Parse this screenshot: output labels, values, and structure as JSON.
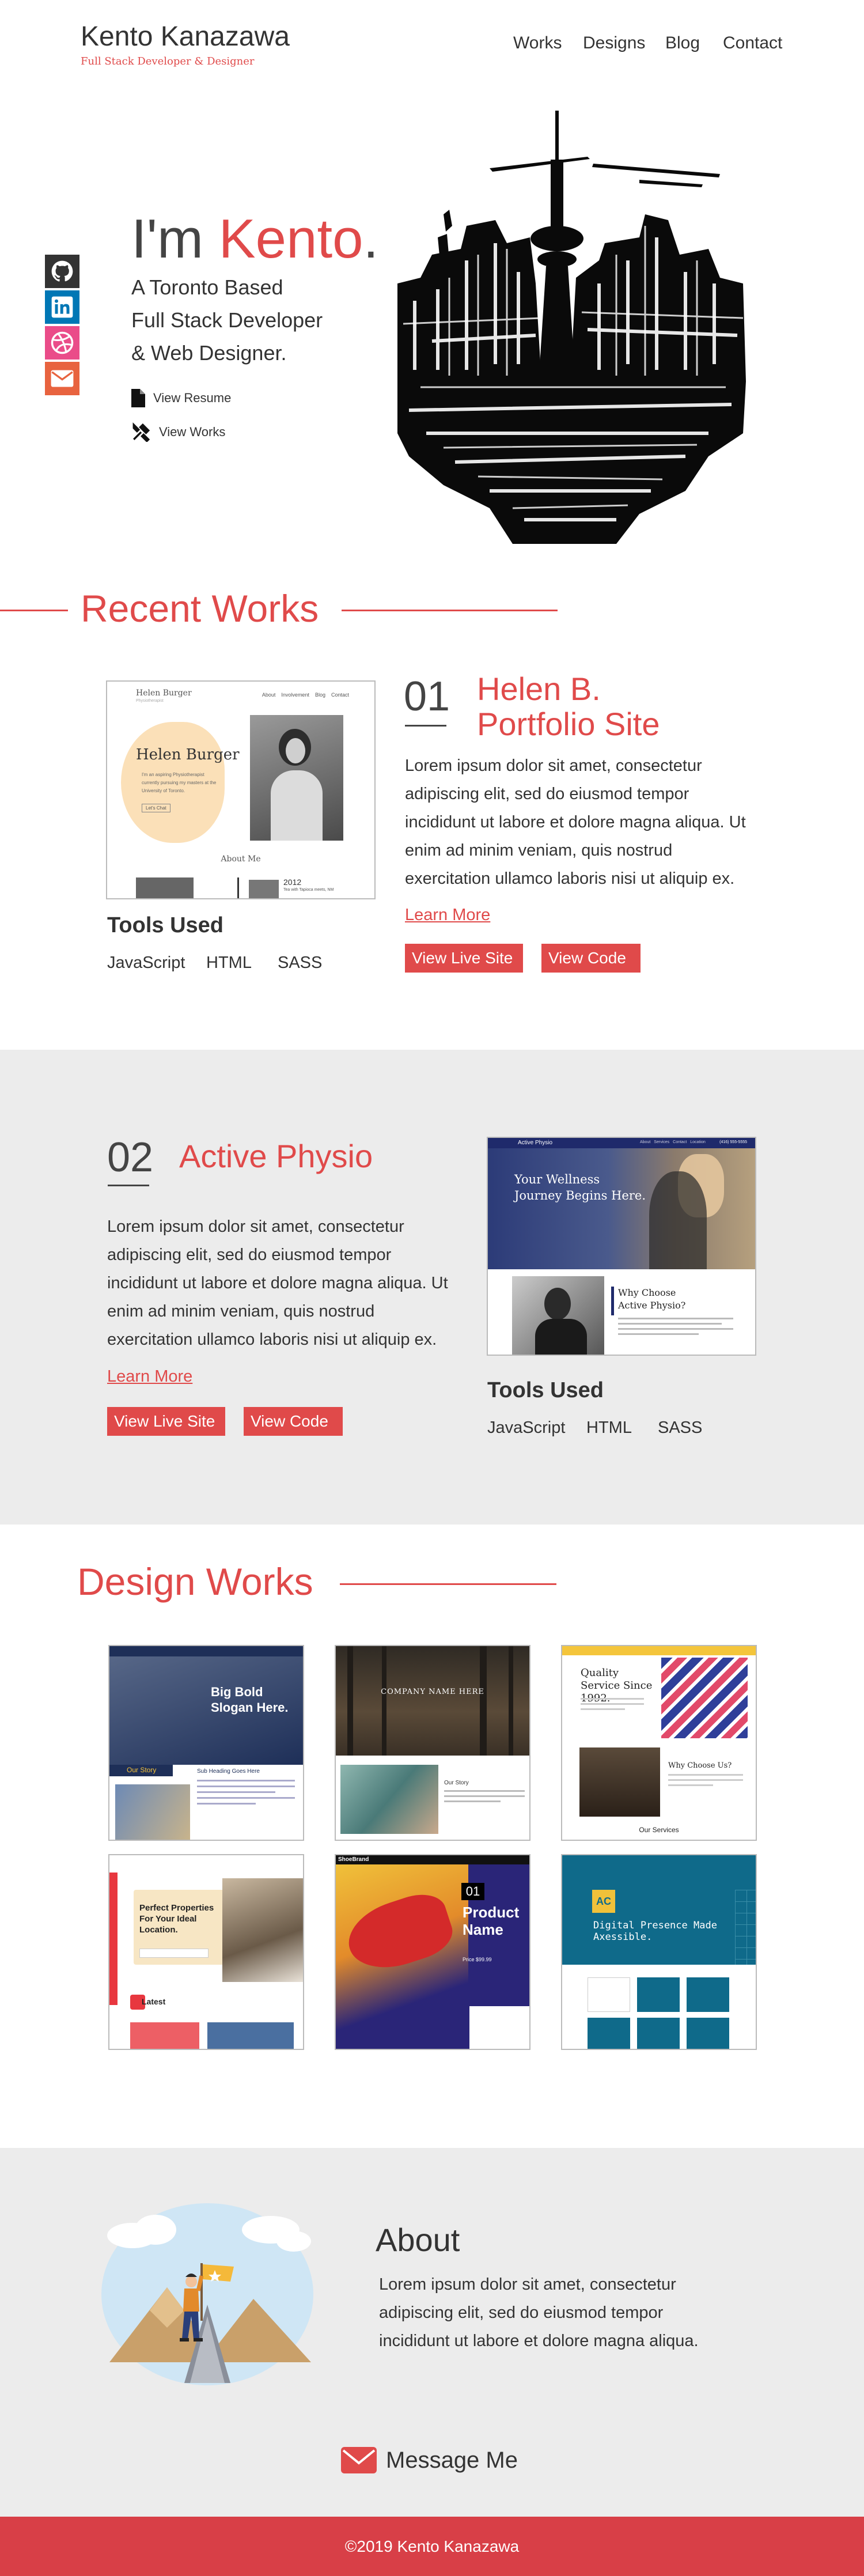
{
  "header": {
    "name": "Kento Kanazawa",
    "tagline": "Full Stack Developer & Designer",
    "nav": [
      "Works",
      "Designs",
      "Blog",
      "Contact"
    ]
  },
  "social": [
    {
      "icon": "github-icon",
      "color": "#333333"
    },
    {
      "icon": "linkedin-icon",
      "color": "#0077b5"
    },
    {
      "icon": "dribbble-icon",
      "color": "#ea4c89"
    },
    {
      "icon": "mail-icon",
      "color": "#e8633f"
    }
  ],
  "hero": {
    "greet_prefix": "I'm ",
    "greet_name": "Kento",
    "greet_suffix": ".",
    "lines": [
      "A Toronto Based",
      "Full Stack Developer",
      "& Web Designer."
    ],
    "resume_label": "View Resume",
    "works_label": "View Works"
  },
  "recent_works": {
    "title": "Recent Works",
    "items": [
      {
        "num": "01",
        "title_line1": "Helen B.",
        "title_line2": "Portfolio Site",
        "desc": "Lorem ipsum dolor sit amet, consectetur adipiscing elit, sed do eiusmod tempor incididunt ut labore et dolore magna aliqua. Ut enim ad minim veniam, quis nostrud exercitation ullamco laboris nisi ut aliquip ex.",
        "learn_more": "Learn More",
        "live_label": "View Live Site",
        "code_label": "View Code",
        "tools_title": "Tools Used",
        "tools": [
          "JavaScript",
          "HTML",
          "SASS"
        ],
        "shot": {
          "brand": "Helen Burger",
          "brand_sub": "Physiotherapist",
          "nav": [
            "About",
            "Involvement",
            "Blog",
            "Contact"
          ],
          "heading": "Helen Burger",
          "copy": "I'm an aspiring Physiotherapist currently pursuing my masters at the University of Toronto.",
          "cta": "Let's Chat",
          "about": "About Me",
          "year": "2012",
          "caption": "Tea with Tapioca meets, NM"
        }
      },
      {
        "num": "02",
        "title_line1": "Active Physio",
        "desc": "Lorem ipsum dolor sit amet, consectetur adipiscing elit, sed do eiusmod tempor incididunt ut labore et dolore magna aliqua. Ut enim ad minim veniam, quis nostrud exercitation ullamco laboris nisi ut aliquip ex.",
        "learn_more": "Learn More",
        "live_label": "View Live Site",
        "code_label": "View Code",
        "tools_title": "Tools Used",
        "tools": [
          "JavaScript",
          "HTML",
          "SASS"
        ],
        "shot": {
          "brand": "Active Physio",
          "nav": [
            "About",
            "Services",
            "Contact",
            "Location"
          ],
          "phone": "(416) 555-5555",
          "hero_line1": "Your Wellness",
          "hero_line2": "Journey Begins Here.",
          "why_line1": "Why Choose",
          "why_line2": "Active Physio?"
        }
      }
    ]
  },
  "design_works": {
    "title": "Design Works",
    "thumbs": [
      {
        "label": "Big Bold Slogan Here.",
        "kind": "blue"
      },
      {
        "label": "COMPANY NAME HERE",
        "kind": "forest"
      },
      {
        "label": "Quality Service Since 1992.",
        "kind": "quality"
      },
      {
        "label": "Perfect Properties For Your Ideal Location.",
        "kind": "realty"
      },
      {
        "label": "Product Name",
        "kind": "shoe"
      },
      {
        "label": "Digital Presence Made Axessible.",
        "kind": "teal"
      }
    ],
    "snippets": {
      "blue_story": "Our Story",
      "blue_head": "Sub Heading Goes Here",
      "forest_our": "Our Story",
      "quality_why": "Why Choose Us?",
      "quality_services": "Our Services",
      "realty_latest": "Latest",
      "shoe_brand": "ShoeBrand",
      "shoe_num": "01",
      "shoe_price": "Price $99.99",
      "teal_logo": "AC"
    }
  },
  "about": {
    "title": "About",
    "text": "Lorem ipsum dolor sit amet, consectetur adipiscing elit, sed do eiusmod tempor incididunt ut labore et dolore magna aliqua."
  },
  "contact": {
    "label": "Message Me"
  },
  "footer": {
    "text": "©2019 Kento Kanazawa"
  },
  "colors": {
    "accent": "#e04a4a",
    "gray_bg": "#ececec",
    "footer": "#d83f47"
  }
}
